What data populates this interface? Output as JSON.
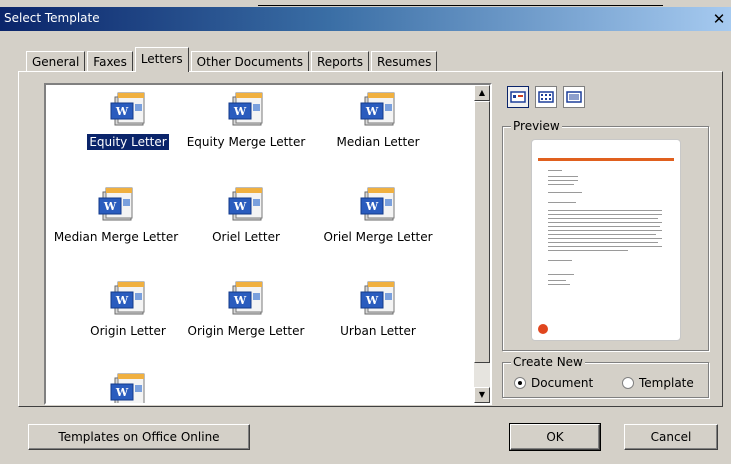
{
  "window": {
    "title": "Select Template",
    "close_glyph": "✕"
  },
  "tabs": [
    "General",
    "Faxes",
    "Letters",
    "Other Documents",
    "Reports",
    "Resumes"
  ],
  "active_tab": "Letters",
  "templates": [
    {
      "label": "Equity Letter",
      "selected": true
    },
    {
      "label": "Equity Merge Letter"
    },
    {
      "label": "Median Letter"
    },
    {
      "label": "Median Merge Letter"
    },
    {
      "label": "Oriel Letter"
    },
    {
      "label": "Oriel Merge Letter"
    },
    {
      "label": "Origin Letter"
    },
    {
      "label": "Origin Merge Letter"
    },
    {
      "label": "Urban Letter"
    },
    {
      "label": ""
    }
  ],
  "preview": {
    "legend": "Preview"
  },
  "create_new": {
    "legend": "Create New",
    "options": [
      "Document",
      "Template"
    ],
    "selected": "Document"
  },
  "buttons": {
    "online": "Templates on Office Online",
    "ok": "OK",
    "cancel": "Cancel"
  },
  "colors": {
    "accent": "#e0601e",
    "title_bar": "#0a246a",
    "selection": "#0a246a"
  }
}
